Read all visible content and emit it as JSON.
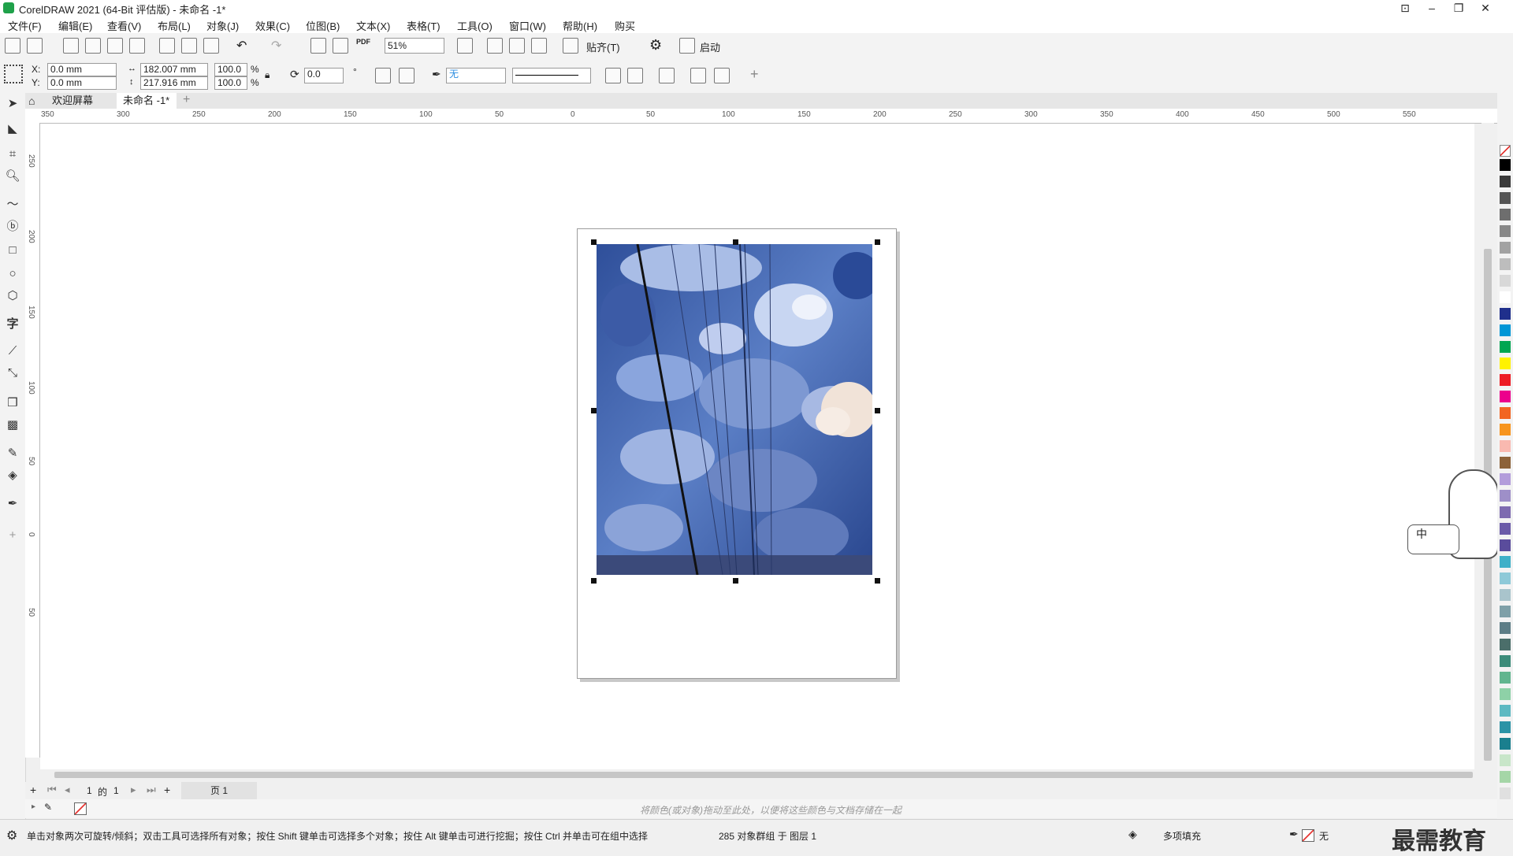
{
  "window": {
    "title": "CorelDRAW 2021 (64-Bit 评估版) - 未命名 -1*"
  },
  "menu": [
    "文件(F)",
    "编辑(E)",
    "查看(V)",
    "布局(L)",
    "对象(J)",
    "效果(C)",
    "位图(B)",
    "文本(X)",
    "表格(T)",
    "工具(O)",
    "窗口(W)",
    "帮助(H)",
    "购买"
  ],
  "toolbar": {
    "zoom": "51%",
    "snap_label": "贴齐(T)",
    "launch_label": "启动",
    "pdf_label": "PDF"
  },
  "property_bar": {
    "x_label": "X:",
    "x_value": "0.0 mm",
    "y_label": "Y:",
    "y_value": "0.0 mm",
    "width": "182.007 mm",
    "height": "217.916 mm",
    "scale_w": "100.0",
    "scale_h": "100.0",
    "percent": "%",
    "rotation": "0.0",
    "degree": "°",
    "outline_fill": "无"
  },
  "tabs": {
    "welcome": "欢迎屏幕",
    "document": "未命名 -1*"
  },
  "ruler": {
    "h_labels": [
      "350",
      "300",
      "250",
      "200",
      "150",
      "100",
      "50",
      "0",
      "50",
      "100",
      "150",
      "200",
      "250",
      "300",
      "350",
      "400",
      "450",
      "500",
      "550"
    ],
    "v_labels": [
      "250",
      "200",
      "150",
      "100",
      "50",
      "0",
      "50"
    ]
  },
  "page_nav": {
    "current": "1",
    "of_text": "的",
    "total": "1",
    "page_tab": "页 1"
  },
  "color_hint": "将颜色(或对象)拖动至此处，以便将这些颜色与文档存储在一起",
  "status": {
    "hint": "单击对象两次可旋转/倾斜；双击工具可选择所有对象；按住 Shift 键单击可选择多个对象；按住 Alt 键单击可进行挖掘；按住 Ctrl 并单击可在组中选择",
    "selection": "285 对象群组 于 图层 1",
    "fill": "多项填充",
    "outline": "无",
    "watermark": "最需教育"
  },
  "ime": {
    "text": "中"
  },
  "palette_colors": [
    "#000000",
    "#3a3a3a",
    "#555555",
    "#6e6e6e",
    "#888888",
    "#a2a2a2",
    "#bdbdbd",
    "#d8d8d8",
    "#ffffff",
    "#1f2f8c",
    "#0096d6",
    "#00a651",
    "#fff200",
    "#ed1c24",
    "#ec008c",
    "#f26522",
    "#f7941d",
    "#f9b9b0",
    "#8c6239",
    "#b39ddb",
    "#9e8fc8",
    "#7e6bb0",
    "#6a5aa8",
    "#5a4c9c",
    "#3fb0c8",
    "#8ec9d8",
    "#a9c4cc",
    "#7fa0a8",
    "#5d7d86",
    "#4b6e6a",
    "#3c8c7a",
    "#62b58f",
    "#8ed1a7",
    "#5db9c2",
    "#2b93a6",
    "#1a7f8e",
    "#c8e6c9",
    "#a5d6a7",
    "#e0e0e0"
  ],
  "colors": {
    "accent": "#2d8ee0",
    "logo": "#1fa14a"
  }
}
